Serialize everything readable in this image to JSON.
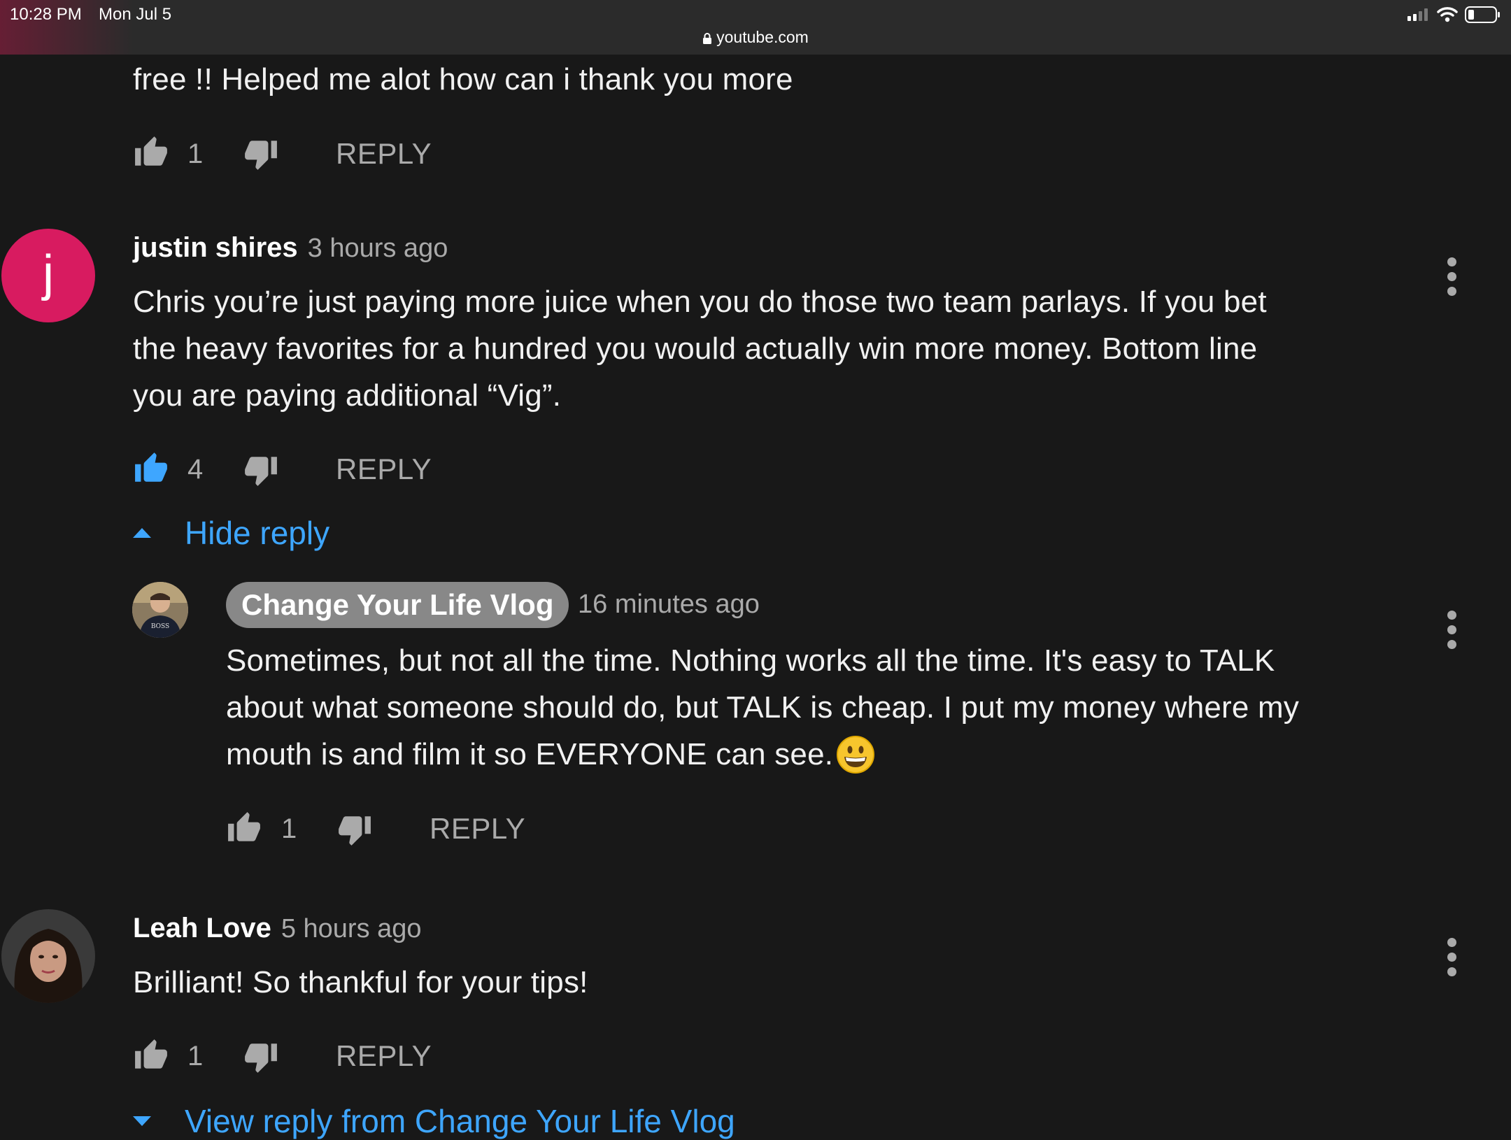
{
  "status_bar": {
    "time": "10:28 PM",
    "date": "Mon Jul 5",
    "url": "youtube.com"
  },
  "comments": [
    {
      "text": "free !! Helped me alot how can i thank you more",
      "likes": "1",
      "reply_label": "REPLY"
    },
    {
      "avatar_letter": "j",
      "avatar_color": "#d81b60",
      "author": "justin shires",
      "time": "3 hours ago",
      "text_lines": [
        "Chris you’re just paying more juice when you do those two team parlays. If you bet",
        "the heavy favorites for a hundred you would actually win more money. Bottom line",
        "you are paying additional “Vig”."
      ],
      "likes": "4",
      "liked": true,
      "reply_label": "REPLY",
      "toggle_label": "Hide reply",
      "replies": [
        {
          "author": "Change Your Life Vlog",
          "time": "16 minutes ago",
          "text_lines": [
            "Sometimes, but not all the time. Nothing works all the time. It's easy to TALK",
            "about what someone should do, but TALK is cheap. I put my money where my",
            "mouth is and film it so EVERYONE can see."
          ],
          "likes": "1",
          "reply_label": "REPLY"
        }
      ]
    },
    {
      "author": "Leah Love",
      "time": "5 hours ago",
      "text": "Brilliant! So thankful for your tips!",
      "likes": "1",
      "reply_label": "REPLY",
      "toggle_label": "View reply from Change Your Life Vlog"
    }
  ],
  "colors": {
    "background": "#181818",
    "link_blue": "#3ea6ff",
    "muted": "#aaaaaa"
  }
}
